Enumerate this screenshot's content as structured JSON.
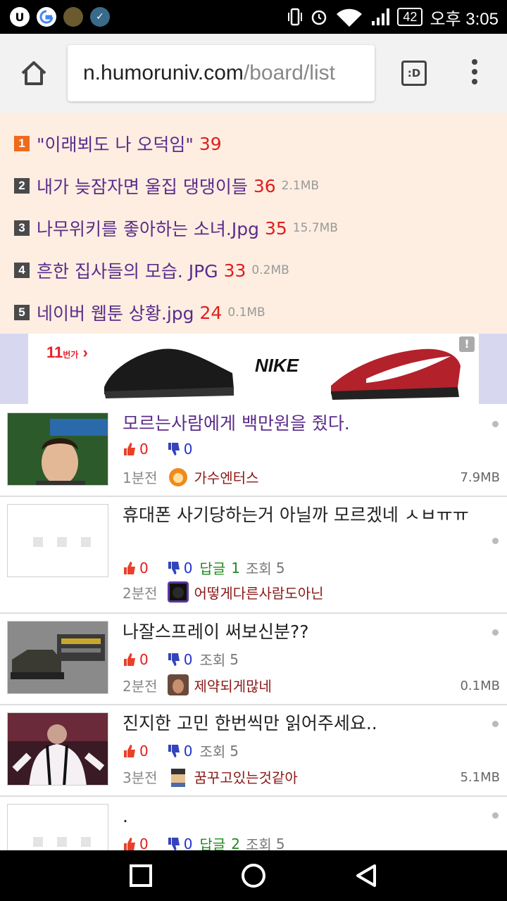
{
  "status_bar": {
    "battery": "42",
    "time": "오후 3:05"
  },
  "browser": {
    "url_host": "n.humoruniv.com",
    "url_path": "/board/list",
    "tabs_label": ":D"
  },
  "best_list": [
    {
      "rank": "1",
      "title": "\"이래뵈도 나 오덕임\"",
      "count": "39",
      "size": ""
    },
    {
      "rank": "2",
      "title": "내가 늦잠자면 울집 댕댕이들",
      "count": "36",
      "size": "2.1MB"
    },
    {
      "rank": "3",
      "title": "나무위키를 좋아하는 소녀.Jpg",
      "count": "35",
      "size": "15.7MB"
    },
    {
      "rank": "4",
      "title": "흔한 집사들의 모습. JPG",
      "count": "33",
      "size": "0.2MB"
    },
    {
      "rank": "5",
      "title": "네이버 웹툰 상황.jpg",
      "count": "24",
      "size": "0.1MB"
    }
  ],
  "ad": {
    "brand": "11",
    "brand_suffix": "번가",
    "product_brand": "NIKE",
    "info_label": "!"
  },
  "posts": [
    {
      "title": "모르는사람에게 백만원을 줬다.",
      "up": "0",
      "down": "0",
      "reply_label": "",
      "reply_count": "",
      "views_label": "",
      "views": "",
      "time": "1분전",
      "author": "가수엔터스",
      "size": "7.9MB"
    },
    {
      "title": "휴대폰 사기당하는거 아닐까 모르겠네 ㅅㅂㅠㅠ",
      "up": "0",
      "down": "0",
      "reply_label": "답글",
      "reply_count": "1",
      "views_label": "조회",
      "views": "5",
      "time": "2분전",
      "author": "어떻게다른사람도아닌",
      "size": ""
    },
    {
      "title": "나잘스프레이 써보신분??",
      "up": "0",
      "down": "0",
      "reply_label": "",
      "reply_count": "",
      "views_label": "조회",
      "views": "5",
      "time": "2분전",
      "author": "제약되게많네",
      "size": "0.1MB"
    },
    {
      "title": "진지한 고민 한번씩만 읽어주세요..",
      "up": "0",
      "down": "0",
      "reply_label": "",
      "reply_count": "",
      "views_label": "조회",
      "views": "5",
      "time": "3분전",
      "author": "꿈꾸고있는것같아",
      "size": "5.1MB"
    },
    {
      "title": ".",
      "up": "0",
      "down": "0",
      "reply_label": "답글",
      "reply_count": "2",
      "views_label": "조회",
      "views": "5",
      "time": "",
      "author": "",
      "size": ""
    }
  ],
  "icons": {
    "status_left": [
      "u-app-icon",
      "google-icon",
      "game-icon",
      "check-icon"
    ],
    "status_right": [
      "vibrate-icon",
      "alarm-icon",
      "wifi-icon",
      "signal-icon",
      "battery-icon"
    ],
    "nav": [
      "recents-icon",
      "home-icon",
      "back-icon"
    ]
  },
  "colors": {
    "visited_title": "#5b2b8a",
    "upvote": "#e01e1e",
    "downvote": "#2233cc",
    "reply": "#1e8a1e",
    "author": "#8b1818",
    "best_bg": "#fdeee1",
    "rank_first": "#f06a1a"
  }
}
